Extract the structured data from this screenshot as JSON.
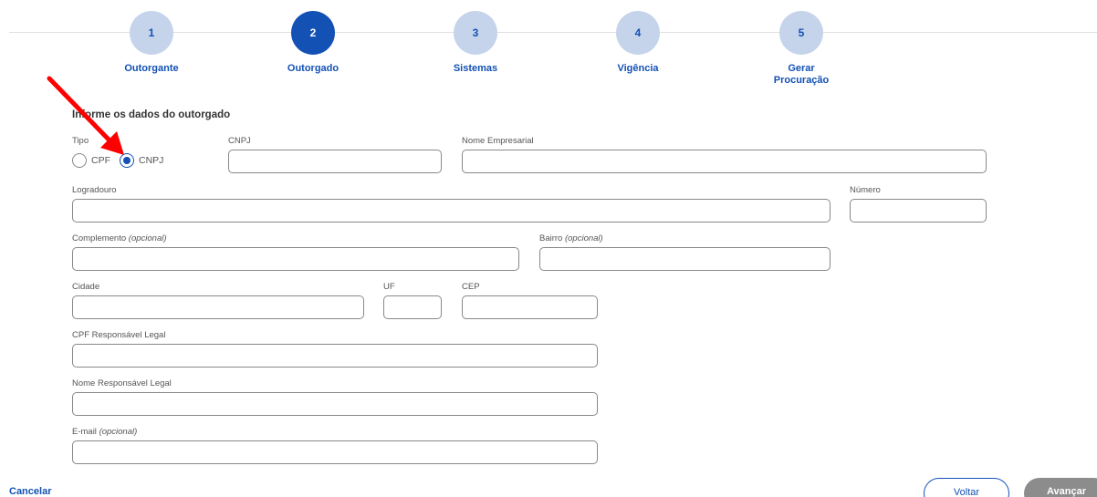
{
  "stepper": {
    "steps": [
      {
        "number": "1",
        "label": "Outorgante",
        "state": "pending"
      },
      {
        "number": "2",
        "label": "Outorgado",
        "state": "active"
      },
      {
        "number": "3",
        "label": "Sistemas",
        "state": "pending"
      },
      {
        "number": "4",
        "label": "Vigência",
        "state": "pending"
      },
      {
        "number": "5",
        "label": "Gerar Procuração",
        "state": "pending"
      }
    ]
  },
  "form": {
    "title": "Informe os dados do outorgado",
    "tipo": {
      "label": "Tipo",
      "options": [
        "CPF",
        "CNPJ"
      ],
      "selected": "CNPJ"
    },
    "cnpj": {
      "label": "CNPJ",
      "value": ""
    },
    "nome_empresarial": {
      "label": "Nome Empresarial",
      "value": ""
    },
    "logradouro": {
      "label": "Logradouro",
      "value": ""
    },
    "numero": {
      "label": "Número",
      "value": ""
    },
    "complemento": {
      "label": "Complemento",
      "optional": "(opcional)",
      "value": ""
    },
    "bairro": {
      "label": "Bairro",
      "optional": "(opcional)",
      "value": ""
    },
    "cidade": {
      "label": "Cidade",
      "value": ""
    },
    "uf": {
      "label": "UF",
      "value": ""
    },
    "cep": {
      "label": "CEP",
      "value": ""
    },
    "cpf_responsavel": {
      "label": "CPF Responsável Legal",
      "value": ""
    },
    "nome_responsavel": {
      "label": "Nome Responsável Legal",
      "value": ""
    },
    "email": {
      "label": "E-mail",
      "optional": "(opcional)",
      "value": ""
    }
  },
  "footer": {
    "cancel_label": "Cancelar",
    "back_label": "Voltar",
    "next_label": "Avançar"
  },
  "colors": {
    "primary": "#1351b4",
    "step_inactive": "#c5d4eb",
    "disabled_button": "#8c8c8c",
    "annotation_arrow": "#ff0000"
  }
}
